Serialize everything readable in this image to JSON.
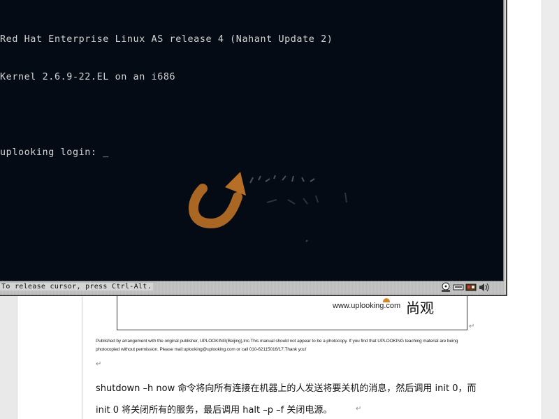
{
  "console": {
    "lines": [
      "Red Hat Enterprise Linux AS release 4 (Nahant Update 2)",
      "Kernel 2.6.9-22.EL on an i686"
    ],
    "login_prompt": "uplooking login: ",
    "cursor": "_"
  },
  "status_bar": {
    "message": "To release cursor, press Ctrl-Alt."
  },
  "tray_icons": [
    "hard-disk-icon",
    "network-icon",
    "sound-card-icon",
    "speaker-icon"
  ],
  "document": {
    "figure_url": "www.uplooking.com",
    "figure_logo_cn": "尚观",
    "notice_line1": "Published by arrangement with the original publisher, UPLOOKING(Beijing),Inc.This manual should not appear to be a photocopy. If you find that UPLOOKING teaching material are being",
    "notice_line2": "photocopied without permission. Please mail:uplooking@uplooking.com or call 010-62115016/17.Thank you!",
    "para_line1": "shutdown –h now  命令将向所有连接在机器上的人发送将要关机的消息，然后调用 init 0，而",
    "para_line2": "init 0 将关闭所有的服务，最后调用 halt  –p  –f  关闭电源。"
  },
  "colors": {
    "console_bg": "#040b14",
    "console_fg": "#d4d4d4",
    "watermark_orange": "#c7782a"
  }
}
